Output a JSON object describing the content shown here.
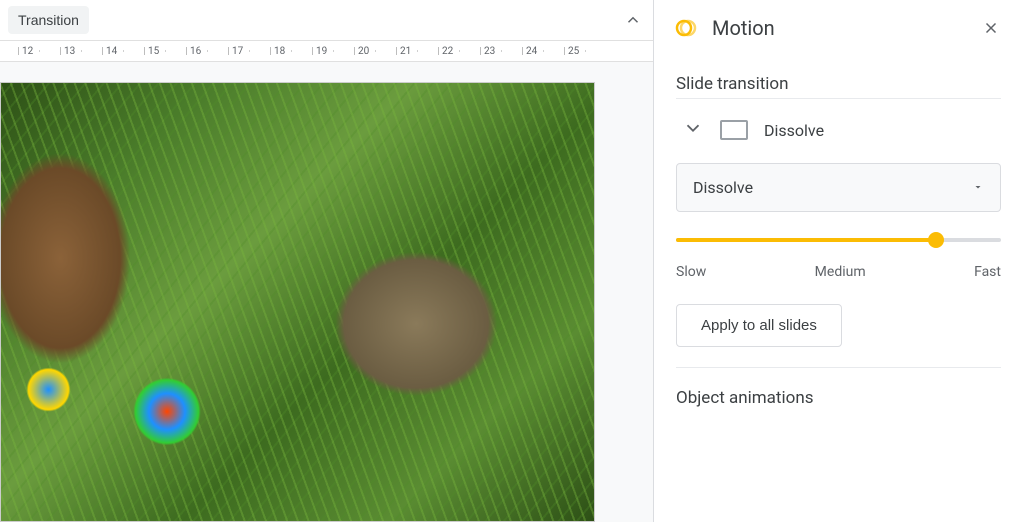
{
  "toolbar": {
    "transition_label": "Transition"
  },
  "ruler": {
    "ticks": [
      12,
      13,
      14,
      15,
      16,
      17,
      18,
      19,
      20,
      21,
      22,
      23,
      24,
      25
    ]
  },
  "motion_panel": {
    "title": "Motion",
    "slide_transition_title": "Slide transition",
    "current_transition": "Dissolve",
    "dropdown_selected": "Dissolve",
    "speed": {
      "value": 80,
      "labels": {
        "slow": "Slow",
        "medium": "Medium",
        "fast": "Fast"
      }
    },
    "apply_all_label": "Apply to all slides",
    "object_animations_title": "Object animations"
  }
}
